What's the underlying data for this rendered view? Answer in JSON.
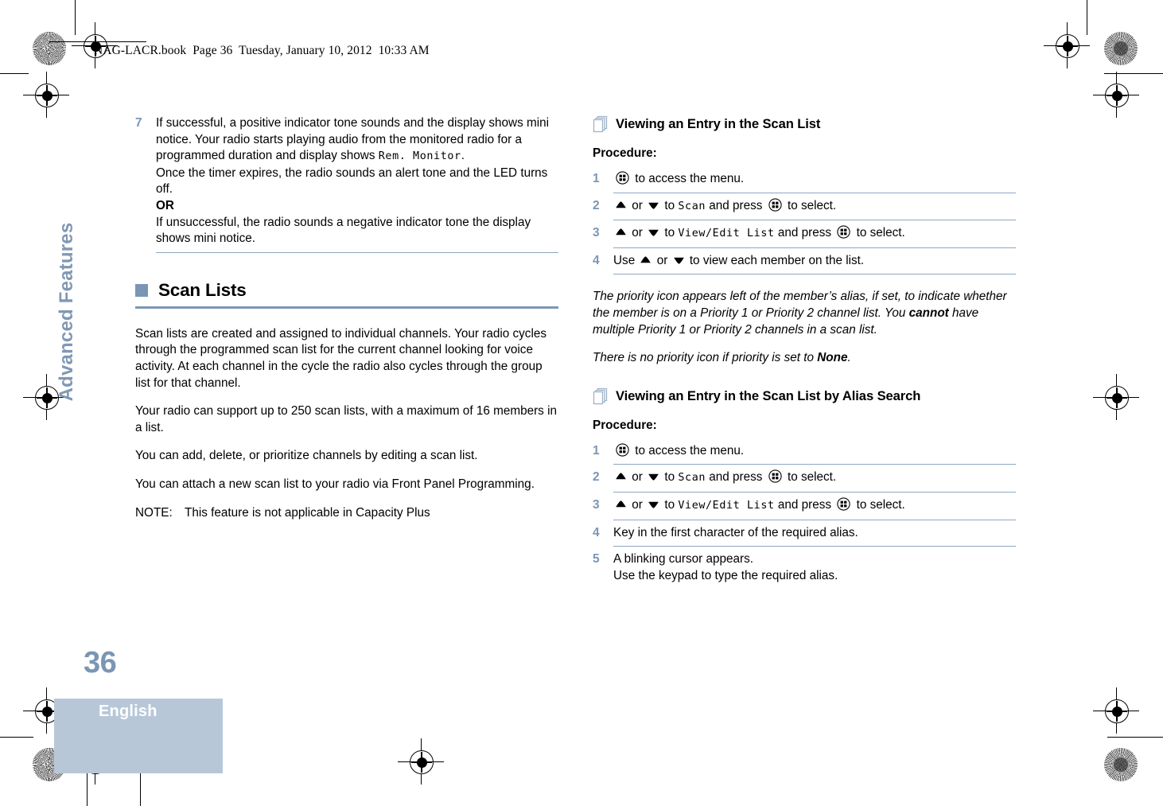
{
  "header": {
    "slug": "NAG-LACR.book  Page 36  Tuesday, January 10, 2012  10:33 AM"
  },
  "sidebar": {
    "chapter_tab": "Advanced Features",
    "page_number": "36",
    "language": "English"
  },
  "colors": {
    "accent": "#7b96b4",
    "rule": "#8fa7c0",
    "band": "#b7c7d8",
    "band_text": "#ffffff"
  },
  "left_column": {
    "step7": {
      "number": "7",
      "line1": "If successful, a positive indicator tone sounds and the display shows mini notice. Your radio starts playing audio from the monitored radio for a programmed duration and display shows ",
      "lcd_text": "Rem. Monitor",
      "line1_end": ".",
      "line2": "Once the timer expires, the radio sounds an alert tone and the LED turns off.",
      "or": "OR",
      "line3": "If unsuccessful, the radio sounds a negative indicator tone the display shows mini notice."
    },
    "chapter": {
      "title": "Scan Lists",
      "paragraphs": [
        "Scan lists are created and assigned to individual channels. Your radio cycles through the programmed scan list for the current channel looking for voice activity. At each channel in the cycle the radio also cycles through the group list for that channel.",
        "Your radio can support up to 250 scan lists, with a maximum of 16 members in a list.",
        "You can add, delete, or prioritize channels by editing a scan list.",
        "You can attach a new scan list to your radio via Front Panel Programming."
      ],
      "note_label": "NOTE:",
      "note_text": "This feature is not applicable in Capacity Plus"
    }
  },
  "right_column": {
    "section1": {
      "title": "Viewing an Entry in the Scan List",
      "procedure_label": "Procedure:",
      "steps": [
        {
          "number": "1",
          "icon": "menu-button-icon",
          "text_after_icon": "to access the menu."
        },
        {
          "number": "2",
          "prefix": "",
          "up": "up-arrow-icon",
          "or": "or",
          "down": "down-arrow-icon",
          "mid": "to",
          "lcd": "Scan",
          "tail": "and press",
          "icon": "menu-button-icon",
          "end": "to select."
        },
        {
          "number": "3",
          "prefix": "",
          "up": "up-arrow-icon",
          "or": "or",
          "down": "down-arrow-icon",
          "mid": "to",
          "lcd": "View/Edit List",
          "tail": "and press",
          "icon": "menu-button-icon",
          "end": "to select."
        },
        {
          "number": "4",
          "prefix": "Use",
          "up": "up-arrow-icon",
          "or": "or",
          "down": "down-arrow-icon",
          "end": "to view each member on the list."
        }
      ],
      "note_italic_1a": "The priority icon appears left of the member’s alias, if set, to indicate whether the member is on a Priority 1 or Priority 2 channel list. You ",
      "note_italic_1b": "cannot",
      "note_italic_1c": " have multiple Priority 1 or Priority 2 channels in a scan list.",
      "note_italic_2a": "There is no priority icon if priority is set to ",
      "note_italic_2b": "None",
      "note_italic_2c": "."
    },
    "section2": {
      "title": "Viewing an Entry in the Scan List by Alias Search",
      "procedure_label": "Procedure:",
      "steps": [
        {
          "number": "1",
          "icon": "menu-button-icon",
          "text_after_icon": "to access the menu."
        },
        {
          "number": "2",
          "up": "up-arrow-icon",
          "or": "or",
          "down": "down-arrow-icon",
          "mid": "to",
          "lcd": "Scan",
          "tail": "and press",
          "icon": "menu-button-icon",
          "end": "to select."
        },
        {
          "number": "3",
          "up": "up-arrow-icon",
          "or": "or",
          "down": "down-arrow-icon",
          "mid": "to",
          "lcd": "View/Edit List",
          "tail": "and press",
          "icon": "menu-button-icon",
          "end": "to select."
        },
        {
          "number": "4",
          "plain": "Key in the first character of the required alias."
        },
        {
          "number": "5",
          "plain_line1": "A blinking cursor appears.",
          "plain_line2": "Use the keypad to type the required alias."
        }
      ]
    }
  }
}
